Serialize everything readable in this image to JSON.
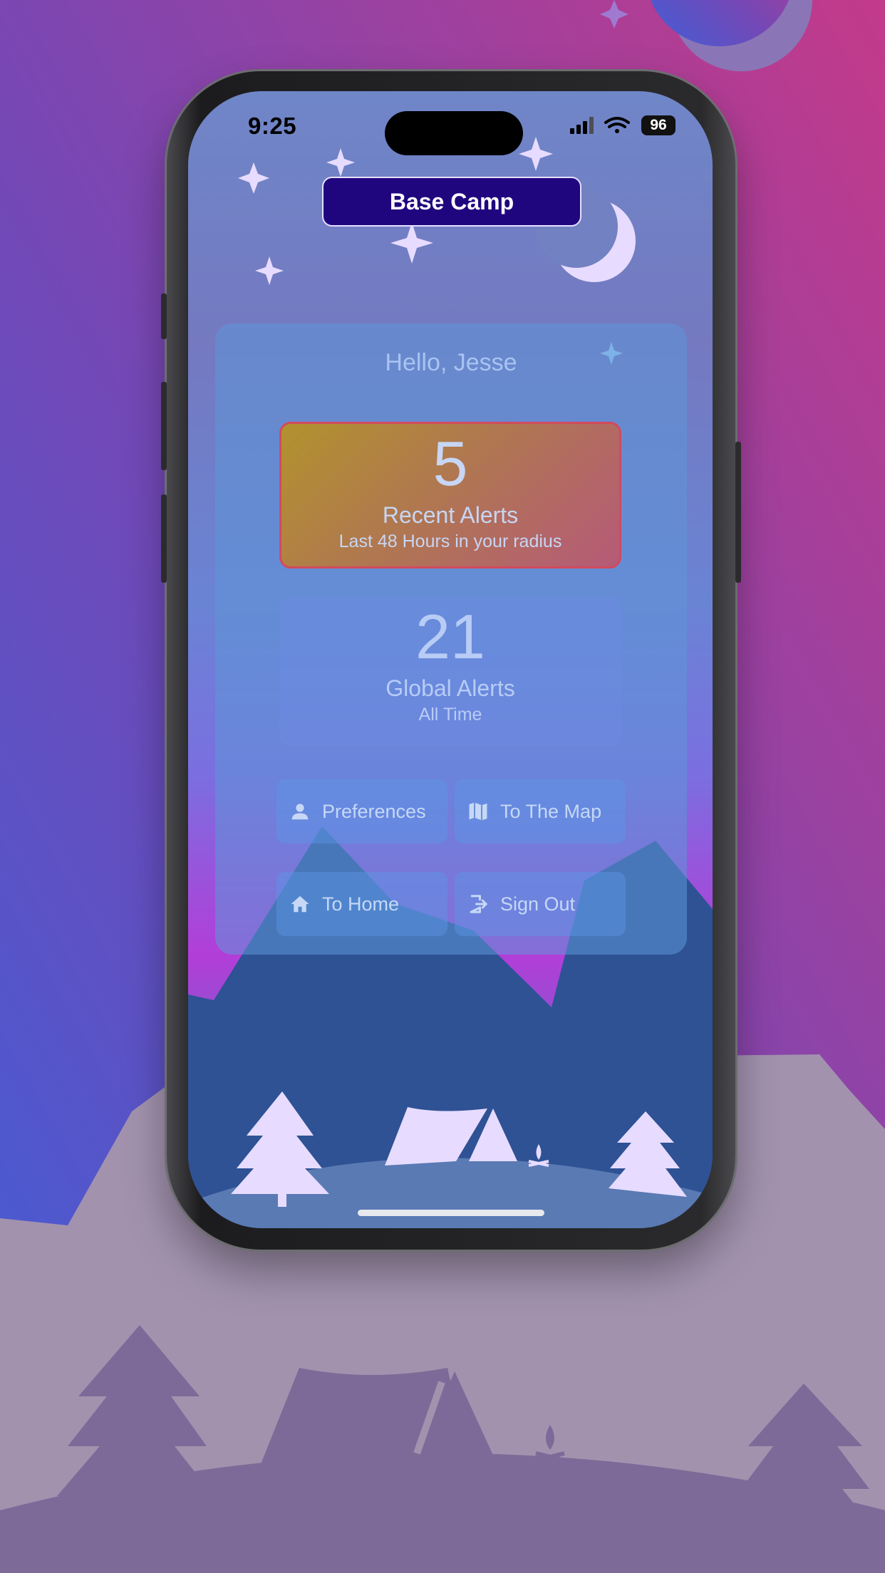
{
  "status_bar": {
    "time": "9:25",
    "battery": "96"
  },
  "header": {
    "title": "Base Camp"
  },
  "greeting": "Hello, Jesse",
  "recent_alerts": {
    "count": "5",
    "label": "Recent Alerts",
    "sublabel": "Last 48 Hours in your radius"
  },
  "global_alerts": {
    "count": "21",
    "label": "Global Alerts",
    "sublabel": "All Time"
  },
  "actions": {
    "preferences": {
      "label": "Preferences",
      "icon": "person-icon"
    },
    "map": {
      "label": "To The Map",
      "icon": "map-icon"
    },
    "home": {
      "label": "To Home",
      "icon": "home-icon"
    },
    "sign_out": {
      "label": "Sign Out",
      "icon": "logout-icon"
    }
  },
  "colors": {
    "title_pill": "#20067e",
    "alert_border": "#d24a5e",
    "night_sky_star": "#e7dcff"
  }
}
